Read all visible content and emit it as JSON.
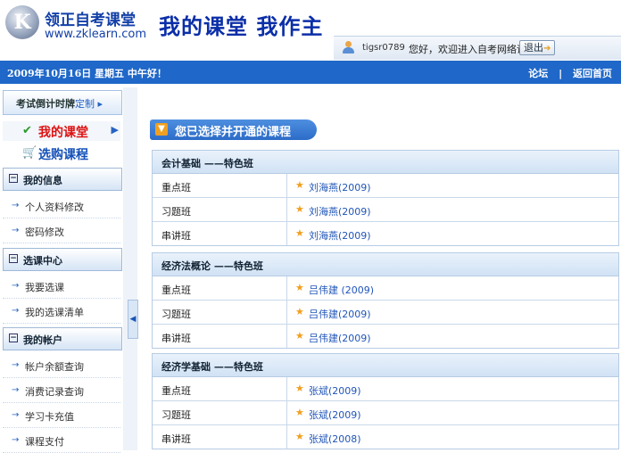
{
  "header": {
    "logo_letter": "K",
    "site_name": "领正自考课堂",
    "site_url": "www.zklearn.com",
    "slogan": "我的课堂  我作主",
    "username": "tigsr0789",
    "welcome": "您好，欢迎进入自考网络课堂！",
    "logout_label": "退出"
  },
  "navbar": {
    "date": "2009年10月16日  星期五  中午好！",
    "links": [
      "论坛",
      "|",
      "返回首页"
    ]
  },
  "sidebar": {
    "countdown_label": "考试倒计时牌",
    "countdown_link": "定制",
    "my_classroom": "我的课堂",
    "buy_course": "选购课程",
    "sections": [
      {
        "title": "我的信息",
        "items": [
          "个人资料修改",
          "密码修改"
        ]
      },
      {
        "title": "选课中心",
        "items": [
          "我要选课",
          "我的选课清单"
        ]
      },
      {
        "title": "我的帐户",
        "items": [
          "帐户余额查询",
          "消费记录查询",
          "学习卡充值",
          "课程支付"
        ]
      }
    ]
  },
  "main": {
    "banner": "您已选择并开通的课程",
    "courses": [
      {
        "title": "会计基础  ——特色班",
        "rows": [
          {
            "cls": "重点班",
            "teacher": "刘海燕(2009)"
          },
          {
            "cls": "习题班",
            "teacher": "刘海燕(2009)"
          },
          {
            "cls": "串讲班",
            "teacher": "刘海燕(2009)"
          }
        ]
      },
      {
        "title": "经济法概论  ——特色班",
        "rows": [
          {
            "cls": "重点班",
            "teacher": "吕伟建 (2009)"
          },
          {
            "cls": "习题班",
            "teacher": "吕伟建(2009)"
          },
          {
            "cls": "串讲班",
            "teacher": "吕伟建(2009)"
          }
        ]
      },
      {
        "title": "经济学基础  ——特色班",
        "rows": [
          {
            "cls": "重点班",
            "teacher": "张斌(2009)"
          },
          {
            "cls": "习题班",
            "teacher": "张斌(2009)"
          },
          {
            "cls": "串讲班",
            "teacher": "张斌(2008)"
          }
        ]
      }
    ]
  }
}
